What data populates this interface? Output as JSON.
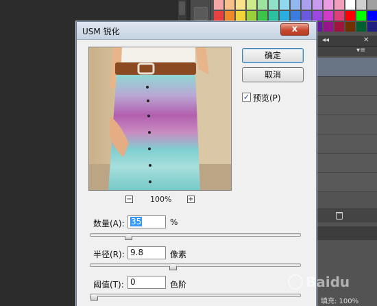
{
  "dialog": {
    "title": "USM 锐化",
    "close_label": "x",
    "ok_label": "确定",
    "cancel_label": "取消",
    "preview_checkbox": {
      "label": "预览(P)",
      "checked": true
    },
    "zoom": {
      "minus": "−",
      "plus": "+",
      "value": "100%"
    },
    "amount": {
      "label": "数量(A):",
      "value": "35",
      "unit": "%",
      "level": 0.17
    },
    "radius": {
      "label": "半径(R):",
      "value": "9.8",
      "unit": "像素",
      "level": 0.39
    },
    "threshold": {
      "label": "阈值(T):",
      "value": "0",
      "unit": "色阶",
      "level": 0.0
    }
  },
  "panels": {
    "fill_label": "填充: 100%"
  },
  "colors": {
    "title_bar": "#c6d3e2",
    "close_button": "#c84a30",
    "dialog_bg": "#f0f0f0",
    "selected_layer": "#697484"
  },
  "icons": [
    "close-icon",
    "zoom-out-icon",
    "zoom-in-icon",
    "checkbox-checked-icon",
    "trash-icon"
  ]
}
